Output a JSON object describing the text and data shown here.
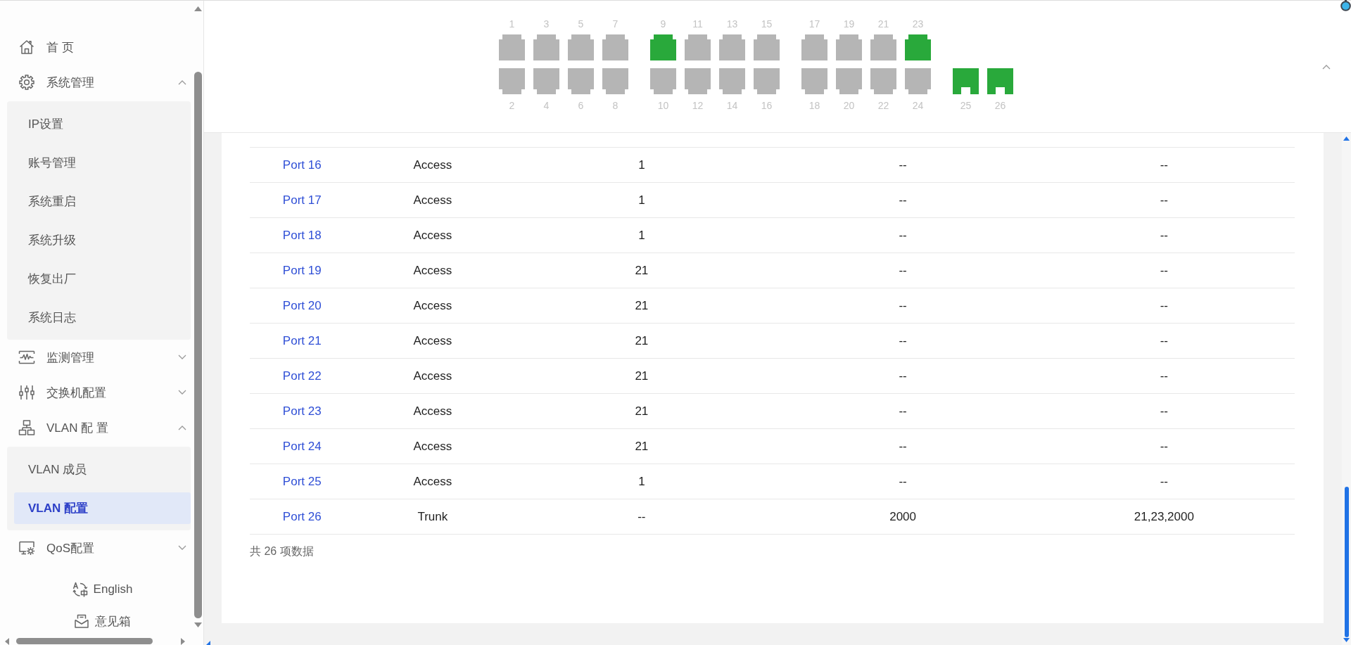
{
  "sidebar": {
    "menu": [
      {
        "label": "首 页",
        "selected": false
      },
      {
        "label": "系统管理",
        "selected": false,
        "expanded": true,
        "children": [
          {
            "label": "IP设置",
            "selected": false
          },
          {
            "label": "账号管理",
            "selected": false
          },
          {
            "label": "系统重启",
            "selected": false
          },
          {
            "label": "系统升级",
            "selected": false
          },
          {
            "label": "恢复出厂",
            "selected": false
          },
          {
            "label": "系统日志",
            "selected": false
          }
        ]
      },
      {
        "label": "监测管理",
        "selected": false,
        "expanded": false
      },
      {
        "label": "交换机配置",
        "selected": false,
        "expanded": false
      },
      {
        "label": "VLAN 配 置",
        "selected": false,
        "expanded": true,
        "children": [
          {
            "label": "VLAN 成员",
            "selected": false
          },
          {
            "label": "VLAN 配置",
            "selected": true
          }
        ]
      },
      {
        "label": "QoS配置",
        "selected": false,
        "expanded": false
      }
    ],
    "footer_links": [
      {
        "label": "English"
      },
      {
        "label": "意见箱"
      }
    ]
  },
  "port_panel": {
    "expanded": true,
    "groups": [
      {
        "kind": "rj45",
        "top": [
          {
            "label": "1",
            "link_up": false
          },
          {
            "label": "3",
            "link_up": false
          },
          {
            "label": "5",
            "link_up": false
          },
          {
            "label": "7",
            "link_up": false
          }
        ],
        "bottom": [
          {
            "label": "2",
            "link_up": false
          },
          {
            "label": "4",
            "link_up": false
          },
          {
            "label": "6",
            "link_up": false
          },
          {
            "label": "8",
            "link_up": false
          }
        ]
      },
      {
        "kind": "rj45",
        "top": [
          {
            "label": "9",
            "link_up": true
          },
          {
            "label": "11",
            "link_up": false
          },
          {
            "label": "13",
            "link_up": false
          },
          {
            "label": "15",
            "link_up": false
          }
        ],
        "bottom": [
          {
            "label": "10",
            "link_up": false
          },
          {
            "label": "12",
            "link_up": false
          },
          {
            "label": "14",
            "link_up": false
          },
          {
            "label": "16",
            "link_up": false
          }
        ]
      },
      {
        "kind": "rj45",
        "top": [
          {
            "label": "17",
            "link_up": false
          },
          {
            "label": "19",
            "link_up": false
          },
          {
            "label": "21",
            "link_up": false
          },
          {
            "label": "23",
            "link_up": true
          }
        ],
        "bottom": [
          {
            "label": "18",
            "link_up": false
          },
          {
            "label": "20",
            "link_up": false
          },
          {
            "label": "22",
            "link_up": false
          },
          {
            "label": "24",
            "link_up": false
          }
        ]
      },
      {
        "kind": "sfp",
        "bottom": [
          {
            "label": "25",
            "link_up": true
          },
          {
            "label": "26",
            "link_up": true
          }
        ]
      }
    ]
  },
  "table": {
    "rows": [
      {
        "cells": [
          "Port 16",
          "Access",
          "1",
          "--",
          "--"
        ]
      },
      {
        "cells": [
          "Port 17",
          "Access",
          "1",
          "--",
          "--"
        ]
      },
      {
        "cells": [
          "Port 18",
          "Access",
          "1",
          "--",
          "--"
        ]
      },
      {
        "cells": [
          "Port 19",
          "Access",
          "21",
          "--",
          "--"
        ]
      },
      {
        "cells": [
          "Port 20",
          "Access",
          "21",
          "--",
          "--"
        ]
      },
      {
        "cells": [
          "Port 21",
          "Access",
          "21",
          "--",
          "--"
        ]
      },
      {
        "cells": [
          "Port 22",
          "Access",
          "21",
          "--",
          "--"
        ]
      },
      {
        "cells": [
          "Port 23",
          "Access",
          "21",
          "--",
          "--"
        ]
      },
      {
        "cells": [
          "Port 24",
          "Access",
          "21",
          "--",
          "--"
        ]
      },
      {
        "cells": [
          "Port 25",
          "Access",
          "1",
          "--",
          "--"
        ]
      },
      {
        "cells": [
          "Port 26",
          "Trunk",
          "--",
          "2000",
          "21,23,2000"
        ]
      }
    ],
    "total": "共 26 项数据"
  }
}
